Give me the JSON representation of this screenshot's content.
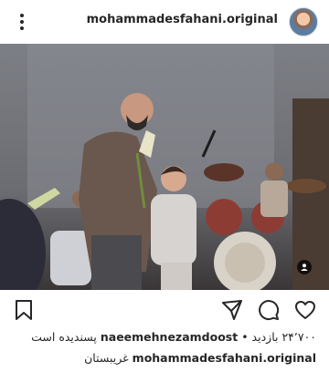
{
  "header": {
    "username": "mohammadesfahani.original",
    "more_icon": "more-vertical-icon",
    "avatar_icon": "profile-avatar"
  },
  "post": {
    "image_description": "",
    "tag_icon": "user-tag-icon"
  },
  "actions": {
    "icons": [
      "bookmark-icon",
      "send-icon",
      "comment-icon",
      "heart-icon"
    ]
  },
  "likes": {
    "count_text": "۲۴٬۷۰۰ بازدید",
    "separator": "•",
    "liked_by": "naeemehnezamdoost",
    "suffix": "پسندیده است"
  },
  "caption": {
    "username": "mohammadesfahani.original",
    "text": "غریبستان"
  },
  "colors": {
    "text": "#262626",
    "background": "#ffffff"
  }
}
